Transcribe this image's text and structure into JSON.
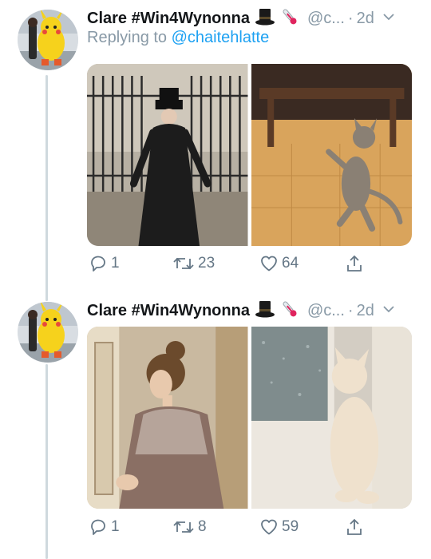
{
  "tweets": [
    {
      "display_name": "Clare #Win4Wynonna",
      "emoji_icons": [
        "top-hat-icon",
        "thermometer-icon"
      ],
      "handle": "@c...",
      "separator": "·",
      "time": "2d",
      "reply_prefix": "Replying to ",
      "reply_to": "@chaitehlatte",
      "media": [
        "photo-victorian-figure-top-hat",
        "photo-kitten-walking"
      ],
      "actions": {
        "replies": "1",
        "retweets": "23",
        "likes": "64"
      }
    },
    {
      "display_name": "Clare #Win4Wynonna",
      "emoji_icons": [
        "top-hat-icon",
        "thermometer-icon"
      ],
      "handle": "@c...",
      "separator": "·",
      "time": "2d",
      "media": [
        "photo-victorian-woman-window",
        "photo-kitten-standing-window"
      ],
      "actions": {
        "replies": "1",
        "retweets": "8",
        "likes": "59"
      }
    }
  ],
  "colors": {
    "link": "#1da1f2",
    "secondary_text": "#8899a6",
    "action_gray": "#657786",
    "thread_line": "#cfd9de"
  }
}
